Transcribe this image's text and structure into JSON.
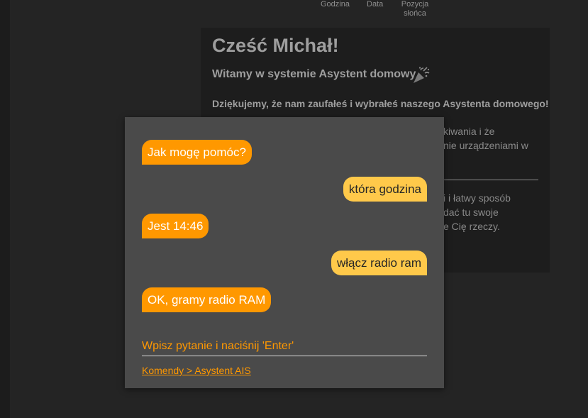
{
  "top_labels": {
    "godzina": "Godzina",
    "data": "Data",
    "pozycja_line1": "Pozycja",
    "pozycja_line2": "słońca"
  },
  "welcome": {
    "title": "Cześć Michał!",
    "subtitle": "Witamy w systemie Asystent domowy",
    "subtitle_icon": "party-popper-icon",
    "thanks": "Dziękujemy, że nam zaufałeś i wybrałeś naszego Asystenta domowego!",
    "fragments": {
      "f1": "kiwania i że",
      "f2": "nie urządzeniami w",
      "f3": "i i łatwy sposób",
      "f4": "dać tu swoje",
      "f5": "e Cię rzeczy."
    }
  },
  "chat": {
    "messages": [
      {
        "from": "assistant",
        "text": "Jak mogę pomóc?"
      },
      {
        "from": "user",
        "text": "która godzina"
      },
      {
        "from": "assistant",
        "text": "Jest 14:46"
      },
      {
        "from": "user",
        "text": "włącz radio ram"
      },
      {
        "from": "assistant",
        "text": "OK, gramy radio RAM"
      }
    ],
    "input_placeholder": "Wpisz pytanie i naciśnij 'Enter'",
    "commands_link": "Komendy > Asystent AIS"
  },
  "colors": {
    "assistant_bubble": "#ff9800",
    "user_bubble": "#ffc94a",
    "chat_panel": "#4a4a4a",
    "background": "#242424"
  }
}
